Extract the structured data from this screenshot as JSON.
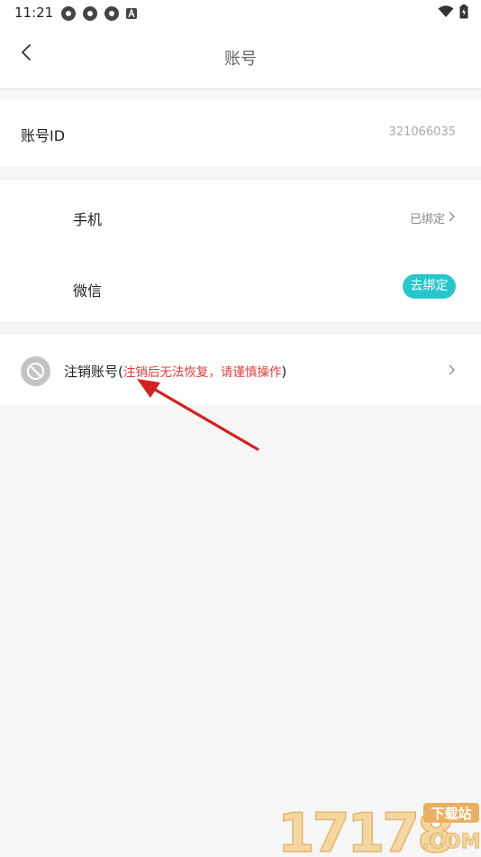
{
  "status_bar": {
    "time": "11:21"
  },
  "header": {
    "title": "账号"
  },
  "account": {
    "id_label": "账号ID",
    "id_value": "321066035"
  },
  "bindings": {
    "phone_label": "手机",
    "phone_status": "已绑定",
    "wechat_label": "微信",
    "wechat_action": "去绑定"
  },
  "cancel": {
    "label": "注销账号",
    "open_paren": "(",
    "warning": "注销后无法恢复，请谨慎操作",
    "close_paren": ")"
  },
  "colors": {
    "accent": "#26c6cb",
    "warning": "#e23b3b",
    "annotation_arrow": "#d61f1f"
  },
  "watermark": {
    "text": "17178下载站"
  }
}
